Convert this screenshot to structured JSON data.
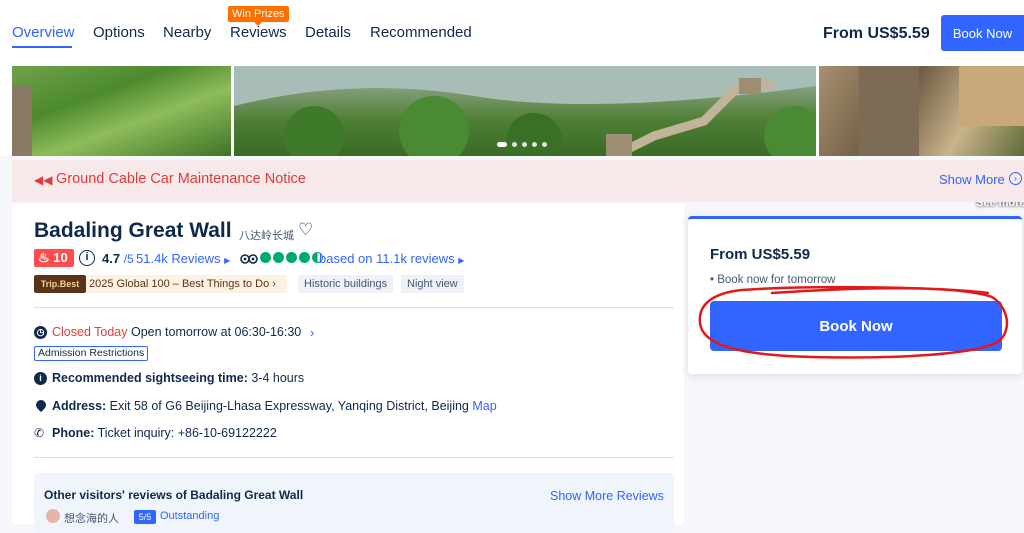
{
  "nav": {
    "tabs": [
      {
        "label": "Overview",
        "active": true
      },
      {
        "label": "Options"
      },
      {
        "label": "Nearby"
      },
      {
        "label": "Reviews"
      },
      {
        "label": "Details"
      },
      {
        "label": "Recommended"
      }
    ],
    "win_badge": "Win Prizes",
    "price": "From US$5.59",
    "book_label": "Book Now"
  },
  "gallery": {
    "see_more": "See more",
    "dot_count": 5,
    "active_dot": 0
  },
  "notice": {
    "icon": "megaphone-icon",
    "text": "Ground Cable Car Maintenance Notice",
    "show_more": "Show More"
  },
  "attraction": {
    "title": "Badaling Great Wall",
    "title_cn": "八达岭长城",
    "hot_rank": "10",
    "rating": "4.7",
    "rating_max": "/5",
    "reviews_count": "51.4k Reviews",
    "tripadvisor_reviews": "based on 11.1k reviews",
    "tripbest_label": "Trip.Best",
    "global_award": "2025 Global 100 – Best Things to Do",
    "tags": [
      "Historic buildings",
      "Night view"
    ],
    "status_closed": "Closed Today",
    "status_open": "Open tomorrow at 06:30-16:30",
    "admission": "Admission Restrictions",
    "sightseeing_label": "Recommended sightseeing time:",
    "sightseeing_value": "3-4 hours",
    "address_label": "Address:",
    "address_value": "Exit 58 of G6 Beijing-Lhasa Expressway, Yanqing District, Beijing",
    "map_link": "Map",
    "phone_label": "Phone:",
    "phone_value": "Ticket inquiry: +86-10-69122222"
  },
  "reviews_box": {
    "title": "Other visitors' reviews of Badaling Great Wall",
    "show_more": "Show More Reviews",
    "reviewer_name": "想念海的人",
    "score": "5/5",
    "score_label": "Outstanding"
  },
  "booking": {
    "price": "From US$5.59",
    "note": "Book now for tomorrow",
    "book_label": "Book Now"
  },
  "colors": {
    "accent": "#3264ff",
    "alert": "#e03b3b",
    "annotation": "#e01a1a"
  }
}
